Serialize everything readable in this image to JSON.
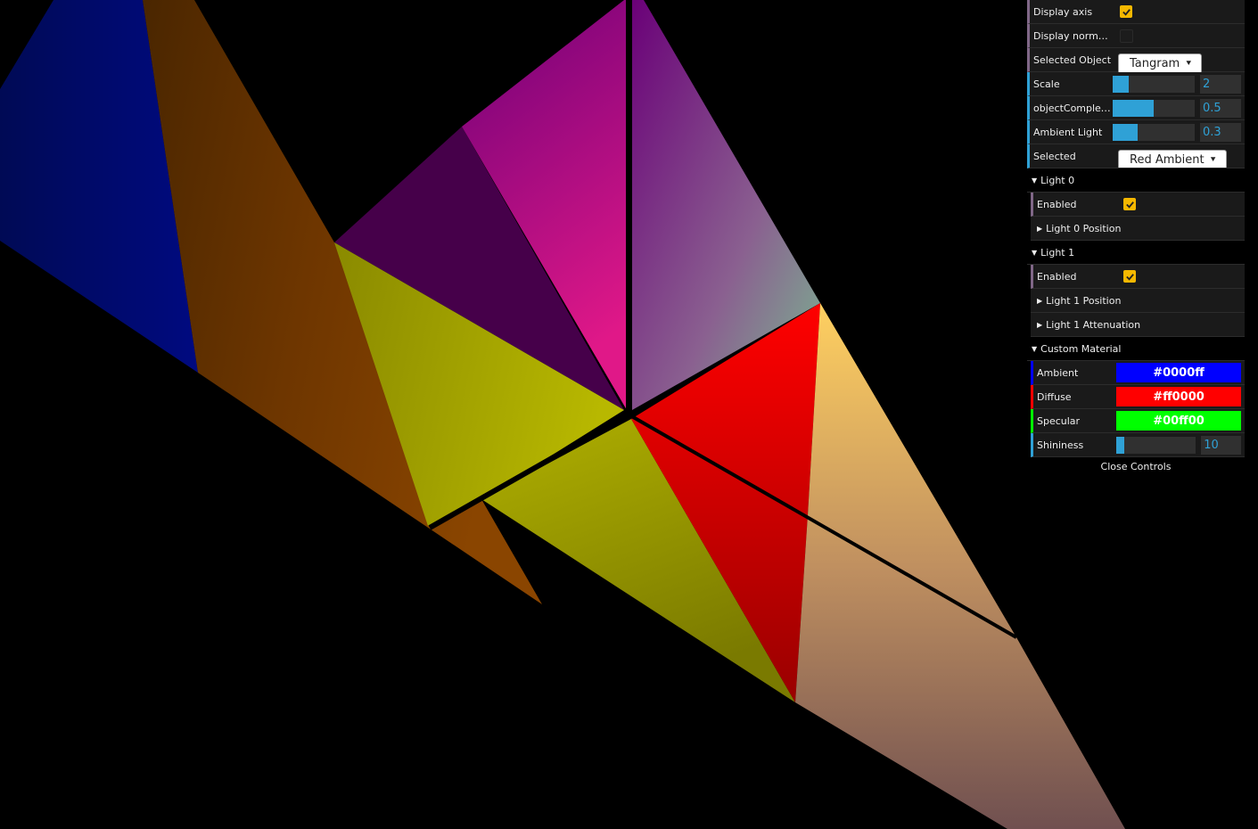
{
  "gui": {
    "display_axis": {
      "label": "Display axis",
      "checked": true
    },
    "display_normals": {
      "label": "Display normals",
      "checked": false
    },
    "selected_object": {
      "label": "Selected Object",
      "value": "Tangram"
    },
    "scale": {
      "label": "Scale",
      "value": "2",
      "fill_fraction": 0.2
    },
    "object_complexity": {
      "label": "objectComplexity",
      "value": "0.5",
      "fill_fraction": 0.5
    },
    "ambient_light": {
      "label": "Ambient Light",
      "value": "0.3",
      "fill_fraction": 0.3
    },
    "selected": {
      "label": "Selected",
      "value": "Red Ambient"
    },
    "light0": {
      "title": "Light 0",
      "enabled_label": "Enabled",
      "enabled": true,
      "position_label": "Light 0 Position"
    },
    "light1": {
      "title": "Light 1",
      "enabled_label": "Enabled",
      "enabled": true,
      "position_label": "Light 1 Position",
      "attenuation_label": "Light 1 Attenuation"
    },
    "custom_material": {
      "title": "Custom Material",
      "ambient": {
        "label": "Ambient",
        "value": "#0000ff"
      },
      "diffuse": {
        "label": "Diffuse",
        "value": "#ff0000"
      },
      "specular": {
        "label": "Specular",
        "value": "#00ff00"
      },
      "shininess": {
        "label": "Shininess",
        "value": "10",
        "fill_fraction": 0.1
      }
    },
    "close_label": "Close Controls"
  },
  "colors": {
    "accent": "#2fa1d6",
    "checkbox": "#f5b800",
    "folder_border": "#806787"
  }
}
